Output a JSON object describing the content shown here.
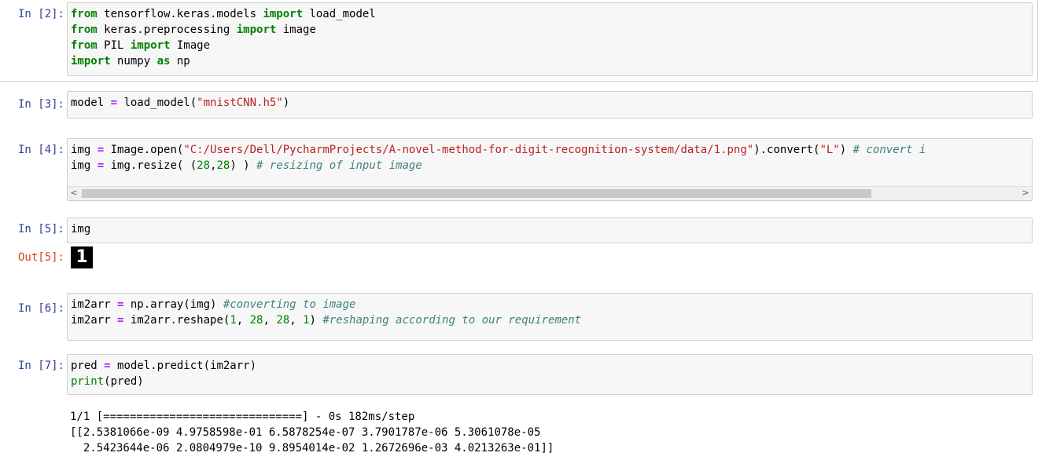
{
  "cells": [
    {
      "prompt": "In [2]:",
      "lines": [
        [
          {
            "t": "from",
            "c": "kw"
          },
          {
            "t": " tensorflow.keras.models ",
            "c": ""
          },
          {
            "t": "import",
            "c": "kw"
          },
          {
            "t": " load_model",
            "c": ""
          }
        ],
        [
          {
            "t": "from",
            "c": "kw"
          },
          {
            "t": " keras.preprocessing ",
            "c": ""
          },
          {
            "t": "import",
            "c": "kw"
          },
          {
            "t": " image",
            "c": ""
          }
        ],
        [
          {
            "t": "from",
            "c": "kw"
          },
          {
            "t": " PIL ",
            "c": ""
          },
          {
            "t": "import",
            "c": "kw"
          },
          {
            "t": " Image",
            "c": ""
          }
        ],
        [
          {
            "t": "import",
            "c": "kw"
          },
          {
            "t": " numpy ",
            "c": ""
          },
          {
            "t": "as",
            "c": "kw"
          },
          {
            "t": " np",
            "c": ""
          }
        ]
      ]
    },
    {
      "prompt": "In [3]:",
      "lines": [
        [
          {
            "t": "model ",
            "c": ""
          },
          {
            "t": "=",
            "c": "op"
          },
          {
            "t": " load_model(",
            "c": ""
          },
          {
            "t": "\"mnistCNN.h5\"",
            "c": "str"
          },
          {
            "t": ")",
            "c": ""
          }
        ]
      ]
    },
    {
      "prompt": "In [4]:",
      "lines": [
        [
          {
            "t": "img ",
            "c": ""
          },
          {
            "t": "=",
            "c": "op"
          },
          {
            "t": " Image.open(",
            "c": ""
          },
          {
            "t": "\"C:/Users/Dell/PycharmProjects/A-novel-method-for-digit-recognition-system/data/1.png\"",
            "c": "str"
          },
          {
            "t": ").convert(",
            "c": ""
          },
          {
            "t": "\"L\"",
            "c": "str"
          },
          {
            "t": ") ",
            "c": ""
          },
          {
            "t": "# convert i",
            "c": "cm"
          }
        ],
        [
          {
            "t": "img ",
            "c": ""
          },
          {
            "t": "=",
            "c": "op"
          },
          {
            "t": " img.resize( (",
            "c": ""
          },
          {
            "t": "28",
            "c": "num"
          },
          {
            "t": ",",
            "c": ""
          },
          {
            "t": "28",
            "c": "num"
          },
          {
            "t": ") ) ",
            "c": ""
          },
          {
            "t": "# resizing of input image",
            "c": "cm"
          }
        ]
      ],
      "scrollbar": {
        "left_arrow": "<",
        "right_arrow": ">"
      }
    },
    {
      "prompt": "In [5]:",
      "lines": [
        [
          {
            "t": "img",
            "c": ""
          }
        ]
      ],
      "output_prompt": "Out[5]:",
      "output_image_text": "1"
    },
    {
      "prompt": "In [6]:",
      "lines": [
        [
          {
            "t": "im2arr ",
            "c": ""
          },
          {
            "t": "=",
            "c": "op"
          },
          {
            "t": " np.array(img) ",
            "c": ""
          },
          {
            "t": "#converting to image",
            "c": "cm"
          }
        ],
        [
          {
            "t": "im2arr ",
            "c": ""
          },
          {
            "t": "=",
            "c": "op"
          },
          {
            "t": " im2arr.reshape(",
            "c": ""
          },
          {
            "t": "1",
            "c": "num"
          },
          {
            "t": ", ",
            "c": ""
          },
          {
            "t": "28",
            "c": "num"
          },
          {
            "t": ", ",
            "c": ""
          },
          {
            "t": "28",
            "c": "num"
          },
          {
            "t": ", ",
            "c": ""
          },
          {
            "t": "1",
            "c": "num"
          },
          {
            "t": ") ",
            "c": ""
          },
          {
            "t": "#reshaping according to our requirement",
            "c": "cm"
          }
        ]
      ]
    },
    {
      "prompt": "In [7]:",
      "lines": [
        [
          {
            "t": "pred ",
            "c": ""
          },
          {
            "t": "=",
            "c": "op"
          },
          {
            "t": " model.predict(im2arr)",
            "c": ""
          }
        ],
        [
          {
            "t": "print",
            "c": "builtin"
          },
          {
            "t": "(pred)",
            "c": ""
          }
        ]
      ],
      "stdout": [
        "1/1 [==============================] - 0s 182ms/step",
        "[[2.5381066e-09 4.9758598e-01 6.5878254e-07 3.7901787e-06 5.3061078e-05",
        "  2.5423644e-06 2.0804979e-10 9.8954014e-02 1.2672696e-03 4.0213263e-01]]"
      ]
    }
  ]
}
